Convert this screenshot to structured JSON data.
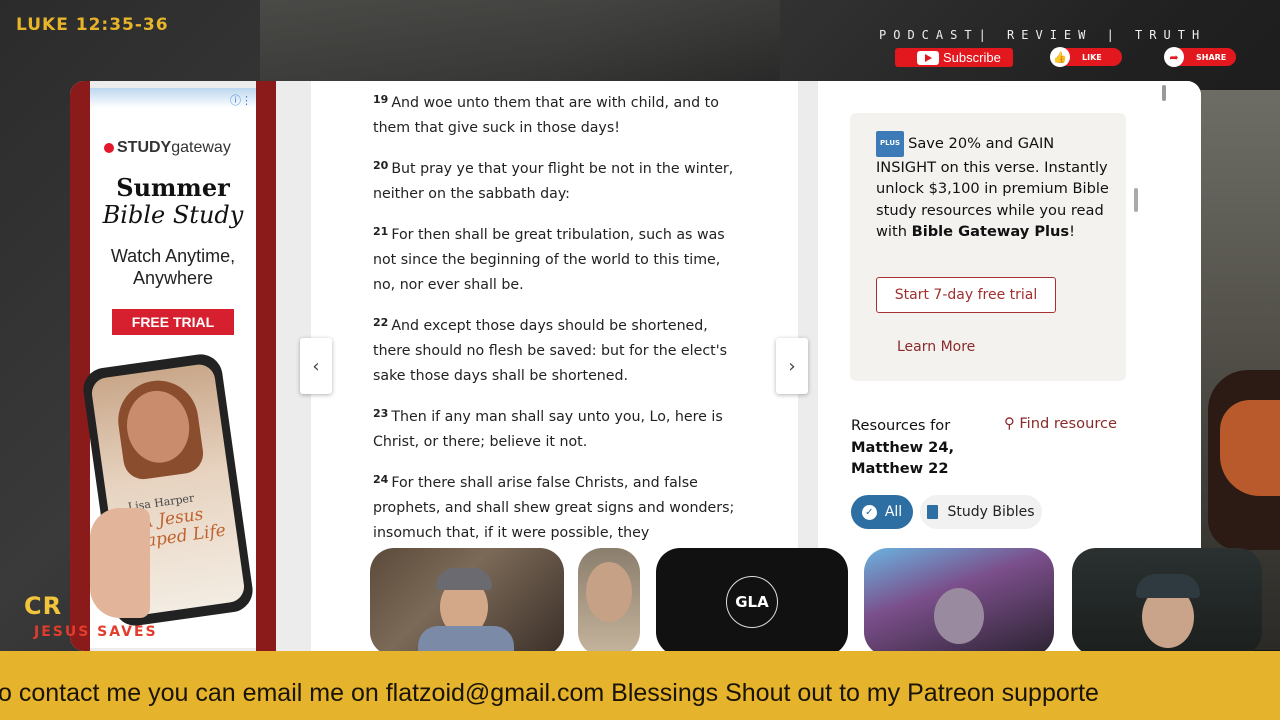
{
  "overlay": {
    "reference": "LUKE 12:35-36",
    "tagline": "PODCAST| REVIEW | TRUTH",
    "subscribe_label": "Subscribe",
    "like_label": "LIKE",
    "share_label": "SHARE",
    "brand_line1": "CR",
    "brand_line2": "JESUS SAVES",
    "ticker": "o contact me you can email me on flatzoid@gmail.com  Blessings   Shout out to my Patreon supporte"
  },
  "ad": {
    "brand_plain": "STUDY",
    "brand_light": "gateway",
    "headline1": "Summer",
    "headline2": "Bible Study",
    "subline": "Watch Anytime, Anywhere",
    "cta": "FREE TRIAL",
    "author": "Lisa Harper",
    "book_title": "A Jesus Shaped Life"
  },
  "passage": {
    "verses": [
      {
        "num": "19",
        "text": "And woe unto them that are with child, and to them that give suck in those days!"
      },
      {
        "num": "20",
        "text": "But pray ye that your flight be not in the winter, neither on the sabbath day:"
      },
      {
        "num": "21",
        "text": "For then shall be great tribulation, such as was not since the beginning of the world to this time, no, nor ever shall be."
      },
      {
        "num": "22",
        "text": "And except those days should be shortened, there should no flesh be saved: but for the elect's sake those days shall be shortened."
      },
      {
        "num": "23",
        "text": "Then if any man shall say unto you, Lo, here is Christ, or there; believe it not."
      },
      {
        "num": "24",
        "text": "For there shall arise false Christs, and false prophets, and shall shew great signs and wonders; insomuch that, if it were possible, they"
      }
    ]
  },
  "promo": {
    "badge": "PLUS",
    "text": "Save 20% and GAIN INSIGHT on this verse. Instantly unlock $3,100 in premium Bible study resources while you read with",
    "brand": "Bible Gateway Plus",
    "brand_suffix": "!",
    "trial_button": "Start 7-day free trial",
    "learn_more": "Learn More"
  },
  "resources": {
    "label": "Resources for",
    "ref1": "Matthew 24,",
    "ref2": "Matthew 22",
    "find": "Find resource",
    "chip_all": "All",
    "chip_study": "Study Bibles"
  },
  "cams": {
    "center_label": "GLA"
  },
  "colors": {
    "accent_gold": "#e5b32c",
    "youtube_red": "#e3181e",
    "link_red": "#8a2a2a",
    "chip_blue": "#2e6fa3"
  }
}
